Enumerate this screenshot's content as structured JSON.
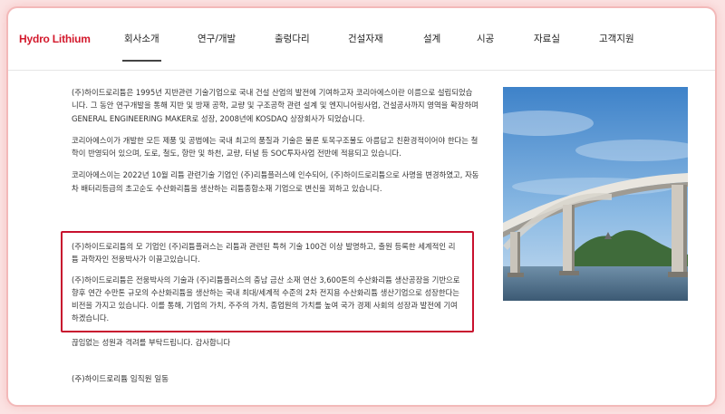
{
  "header": {
    "logo": "Hydro Lithium",
    "nav": [
      {
        "label": "회사소개",
        "active": true
      },
      {
        "label": "연구/개발"
      },
      {
        "label": "출렁다리"
      },
      {
        "label": "건설자재"
      },
      {
        "label": "설계"
      },
      {
        "label": "시공"
      },
      {
        "label": "자료실"
      },
      {
        "label": "고객지원"
      }
    ]
  },
  "content": {
    "paragraphs": [
      "(주)하이드로리튬은 1995년 지반관련 기술기업으로 국내 건설 산업의 발전에 기여하고자 코리아에스이란 이름으로 설립되었습니다. 그 동안 연구개발을 통해 지반 및 방재 공학, 교량 및 구조공학 관련 설계 및 엔지니어링사업, 건설공사까지 영역을 확장하며 GENERAL ENGINEERING MAKER로 성장, 2008년에 KOSDAQ 상장회사가 되었습니다.",
      "코리아에스이가 개발한 모든 제품 및 공법에는 국내 최고의 품질과 기술은 물론 토목구조물도 아름답고 친환경적이어야 한다는 철학이 반영되어 있으며, 도로, 철도, 항만 및 하천, 교량, 터널 등 SOC투자사업 전반에 적용되고 있습니다.",
      "코리아에스이는 2022년 10월 리튬 관련기술 기업인 (주)리튬플러스에 인수되어, (주)하이드로리튬으로 사명을 변경하였고, 자동차 배터리등급의 초고순도 수산화리튬을 생산하는 리튬종합소재 기업으로 변신을 꾀하고 있습니다."
    ],
    "highlight": [
      "(주)하이드로리튬의 모 기업인 (주)리튬플러스는 리튬과 관련된 특허 기술 100건 이상 발명하고, 출원 등록한 세계적인 리튬 과학자인 전웅박사가 이끌고있습니다.",
      "(주)하이드로리튬은 전웅박사의 기술과 (주)리튬플러스의 충남 금산 소재 연산 3,600톤의 수산화리튬 생산공장을 기반으로 향후 연간 수만톤 규모의 수산화리튬을 생산하는 국내 최대/세계적 수준의 2차 전지용 수산화리튬 생산기업으로 성장한다는 비전을 가지고 있습니다. 이를 통해, 기업의 가치, 주주의 가치, 종업원의 가치를 높여 국가 경제 사회의 성장과 발전에 기여하겠습니다."
    ],
    "closing": "끊임없는 성원과 격려를 부탁드립니다. 감사합니다",
    "signature": "(주)하이드로리튬 임직원 일동"
  }
}
